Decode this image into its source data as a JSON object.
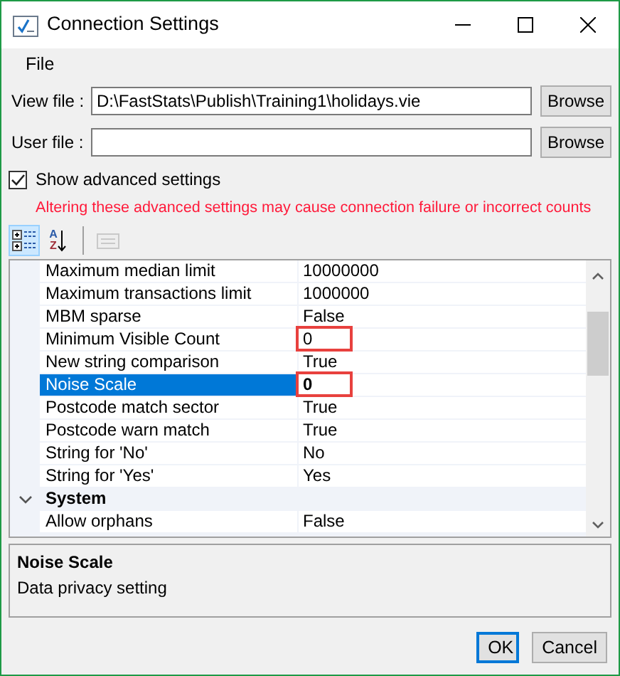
{
  "window": {
    "title": "Connection Settings"
  },
  "menu": [
    "File"
  ],
  "fields": [
    {
      "label": "View file :",
      "value": "D:\\FastStats\\Publish\\Training1\\holidays.vie",
      "button": "Browse"
    },
    {
      "label": "User file :",
      "button": "Browse"
    }
  ],
  "show_advanced": {
    "label": "Show advanced settings",
    "checked": true
  },
  "warning": "Altering these advanced settings may cause connection failure or incorrect counts",
  "toolbar": [
    {
      "kind": "categorized",
      "selected": true,
      "disabled": false
    },
    {
      "kind": "alphabetical",
      "letters": [
        "A",
        "Z"
      ],
      "selected": false,
      "disabled": false
    },
    {
      "kind": "pages",
      "selected": false,
      "disabled": true
    }
  ],
  "properties": [
    {
      "kind": "property",
      "name": "Maximum median limit",
      "value": "10000000",
      "selected": false,
      "modified": false,
      "highlighted": false
    },
    {
      "kind": "property",
      "name": "Maximum transactions limit",
      "value": "1000000",
      "selected": false,
      "modified": false,
      "highlighted": false
    },
    {
      "kind": "property",
      "name": "MBM sparse",
      "value": "False",
      "selected": false,
      "modified": false,
      "highlighted": false
    },
    {
      "kind": "property",
      "name": "Minimum Visible Count",
      "value": "0",
      "selected": false,
      "modified": false,
      "highlighted": true
    },
    {
      "kind": "property",
      "name": "New string comparison",
      "value": "True",
      "selected": false,
      "modified": false,
      "highlighted": false
    },
    {
      "kind": "property",
      "name": "Noise Scale",
      "value": "0",
      "selected": true,
      "modified": true,
      "highlighted": true
    },
    {
      "kind": "property",
      "name": "Postcode match sector",
      "value": "True",
      "selected": false,
      "modified": false,
      "highlighted": false
    },
    {
      "kind": "property",
      "name": "Postcode warn match",
      "value": "True",
      "selected": false,
      "modified": false,
      "highlighted": false
    },
    {
      "kind": "property",
      "name": "String for 'No'",
      "value": "No",
      "selected": false,
      "modified": false,
      "highlighted": false
    },
    {
      "kind": "property",
      "name": "String for 'Yes'",
      "value": "Yes",
      "selected": false,
      "modified": false,
      "highlighted": false
    },
    {
      "kind": "category",
      "name": "System",
      "expanded": true
    },
    {
      "kind": "property",
      "name": "Allow orphans",
      "value": "False",
      "selected": false,
      "modified": false,
      "highlighted": false
    }
  ],
  "description": {
    "title": "Noise Scale",
    "text": "Data privacy setting"
  },
  "buttons": [
    {
      "label": "OK",
      "default": true
    },
    {
      "label": "Cancel",
      "default": false
    }
  ]
}
